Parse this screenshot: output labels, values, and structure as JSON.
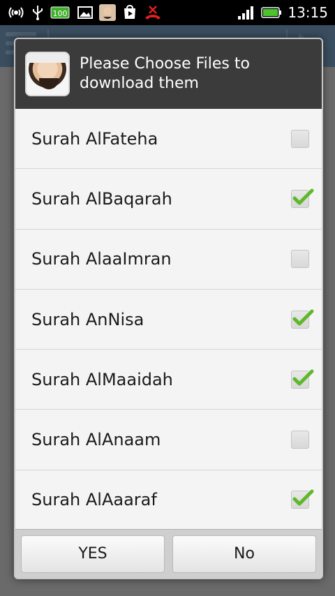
{
  "status_bar": {
    "time": "13:15",
    "battery_level_badge": "100",
    "icons_left": [
      "wireless-hotspot-icon",
      "usb-icon",
      "battery-100-icon",
      "image-icon",
      "avatar-icon",
      "play-store-icon",
      "missed-call-icon"
    ],
    "icons_right": [
      "signal-strength-icon",
      "battery-icon"
    ]
  },
  "dialog": {
    "title": "Please Choose Files to download them",
    "items": [
      {
        "label": "Surah AlFateha",
        "checked": false
      },
      {
        "label": "Surah AlBaqarah",
        "checked": true
      },
      {
        "label": "Surah AlaaImran",
        "checked": false
      },
      {
        "label": "Surah AnNisa",
        "checked": true
      },
      {
        "label": "Surah AlMaaidah",
        "checked": true
      },
      {
        "label": "Surah AlAnaam",
        "checked": false
      },
      {
        "label": "Surah AlAaaraf",
        "checked": true
      }
    ],
    "buttons": {
      "yes": "YES",
      "no": "No"
    }
  },
  "colors": {
    "dialog_header": "#3b3b3b",
    "check_green": "#5fb82a",
    "status_bar": "#000000"
  }
}
